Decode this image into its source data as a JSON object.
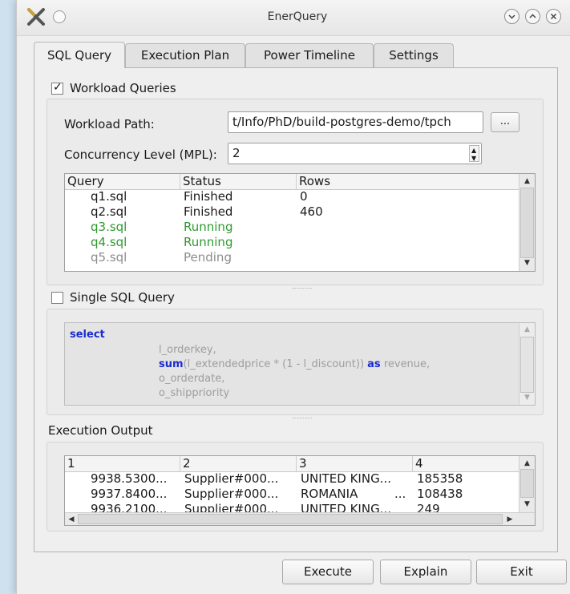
{
  "window": {
    "title": "EnerQuery"
  },
  "tabs": [
    "SQL Query",
    "Execution Plan",
    "Power Timeline",
    "Settings"
  ],
  "workload": {
    "checkbox_label": "Workload Queries",
    "checked": true,
    "path_label": "Workload Path:",
    "path_value": "t/Info/PhD/build-postgres-demo/tpch",
    "browse_label": "...",
    "mpl_label": "Concurrency Level (MPL):",
    "mpl_value": "2",
    "columns": [
      "Query",
      "Status",
      "Rows"
    ],
    "rows": [
      {
        "query": "q1.sql",
        "status": "Finished",
        "rows": "0",
        "color": "#1a1a1a"
      },
      {
        "query": "q2.sql",
        "status": "Finished",
        "rows": "460",
        "color": "#1a1a1a"
      },
      {
        "query": "q3.sql",
        "status": "Running",
        "rows": "",
        "color": "#2f9a2f"
      },
      {
        "query": "q4.sql",
        "status": "Running",
        "rows": "",
        "color": "#2f9a2f"
      },
      {
        "query": "q5.sql",
        "status": "Pending",
        "rows": "",
        "color": "#8c8c8c"
      }
    ]
  },
  "single": {
    "checkbox_label": "Single SQL Query",
    "checked": false,
    "code": {
      "kw_select": "select",
      "l1": "l_orderkey,",
      "kw_sum": "sum",
      "l2_mid": "(l_extendedprice * (1 - l_discount))",
      "kw_as": "as",
      "l2_end": "revenue,",
      "l3": "o_orderdate,",
      "l4": "o_shippriority"
    }
  },
  "output": {
    "label": "Execution Output",
    "columns": [
      "1",
      "2",
      "3",
      "4"
    ],
    "rows": [
      [
        "9938.5300...",
        "Supplier#000...",
        "UNITED KING...",
        "185358"
      ],
      [
        "9937.8400...",
        "Supplier#000...",
        "ROMANIA",
        "108438"
      ],
      [
        "9936.2100...",
        "Supplier#000...",
        "UNITED KING...",
        "249"
      ]
    ],
    "ellipsis": "..."
  },
  "buttons": {
    "execute": "Execute",
    "explain": "Explain",
    "exit": "Exit"
  }
}
